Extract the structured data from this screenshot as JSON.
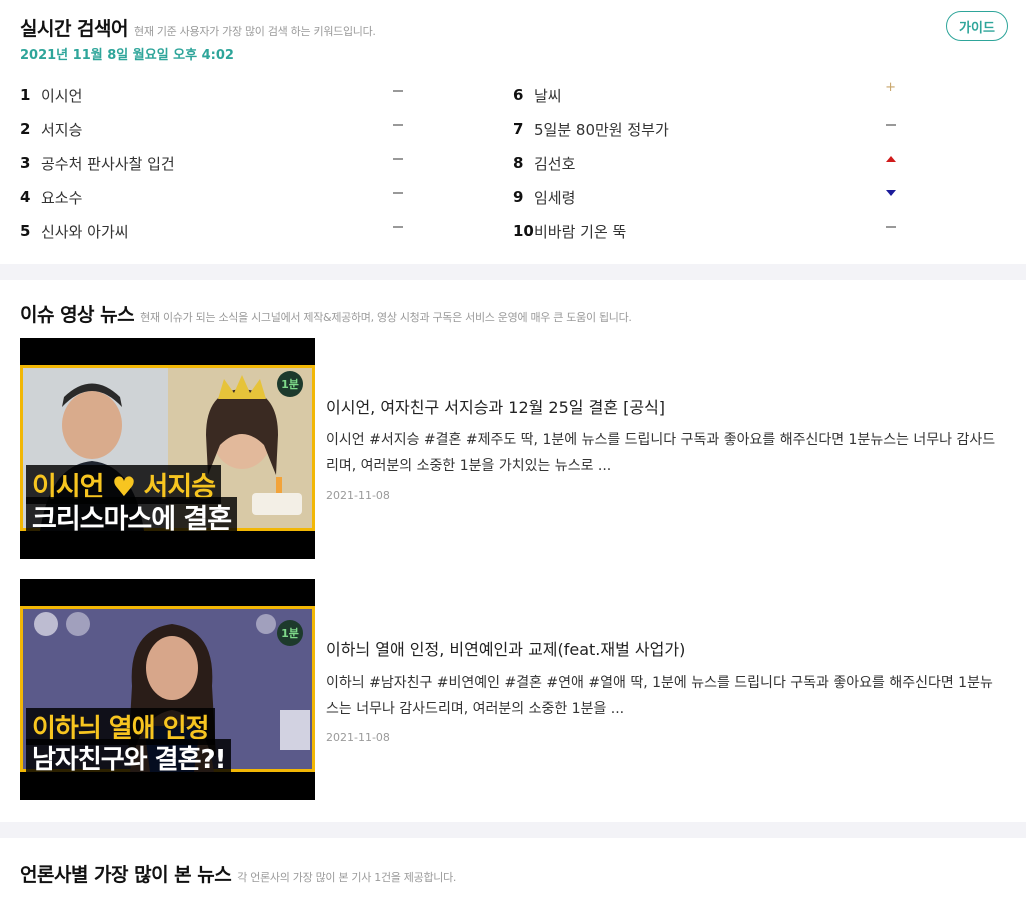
{
  "trending": {
    "title": "실시간 검색어",
    "description": "현재 기준 사용자가 가장 많이 검색 하는 키워드입니다.",
    "timestamp": "2021년 11월 8일 월요일 오후 4:02",
    "guide_label": "가이드",
    "left": [
      {
        "rank": "1",
        "keyword": "이시언",
        "trend": "same"
      },
      {
        "rank": "2",
        "keyword": "서지승",
        "trend": "same"
      },
      {
        "rank": "3",
        "keyword": "공수처 판사사찰 입건",
        "trend": "same"
      },
      {
        "rank": "4",
        "keyword": "요소수",
        "trend": "same"
      },
      {
        "rank": "5",
        "keyword": "신사와 아가씨",
        "trend": "same"
      }
    ],
    "right": [
      {
        "rank": "6",
        "keyword": "날씨",
        "trend": "new"
      },
      {
        "rank": "7",
        "keyword": "5일분 80만원 정부가",
        "trend": "same"
      },
      {
        "rank": "8",
        "keyword": "김선호",
        "trend": "up"
      },
      {
        "rank": "9",
        "keyword": "임세령",
        "trend": "down"
      },
      {
        "rank": "10",
        "keyword": "비바람 기온 뚝",
        "trend": "same"
      }
    ]
  },
  "video_news": {
    "title": "이슈 영상 뉴스",
    "description": "현재 이슈가 되는 소식을 시그널에서 제작&제공하며, 영상 시청과 구독은 서비스 운영에 매우 큰 도움이 됩니다.",
    "items": [
      {
        "title": "이시언, 여자친구 서지승과 12월 25일 결혼 [공식]",
        "desc": "이시언 #서지승 #결혼 #제주도 딱, 1분에 뉴스를 드립니다 구독과 좋아요를 해주신다면 1분뉴스는 너무나 감사드리며, 여러분의 소중한 1분을 가치있는 뉴스로 ...",
        "date": "2021-11-08",
        "thumb_line1": "이시언 ♥ 서지승",
        "thumb_line2": "크리스마스에 결혼",
        "badge": "1분"
      },
      {
        "title": "이하늬 열애 인정, 비연예인과 교제(feat.재벌 사업가)",
        "desc": "이하늬 #남자친구 #비연예인 #결혼 #연애 #열애 딱, 1분에 뉴스를 드립니다 구독과 좋아요를 해주신다면 1분뉴스는 너무나 감사드리며, 여러분의 소중한 1분을 ...",
        "date": "2021-11-08",
        "thumb_line1": "이하늬 열애 인정",
        "thumb_line2": "남자친구와 결혼?!",
        "badge": "1분"
      }
    ]
  },
  "press_news": {
    "title": "언론사별 가장 많이 본 뉴스",
    "description": "각 언론사의 가장 많이 본 기사 1건을 제공합니다."
  },
  "colors": {
    "accent": "#2ea59a",
    "trend_up": "#d01b1b",
    "trend_down": "#1b1b9a",
    "trend_new": "#c9a66b",
    "thumb_text_yellow": "#f7c520"
  }
}
